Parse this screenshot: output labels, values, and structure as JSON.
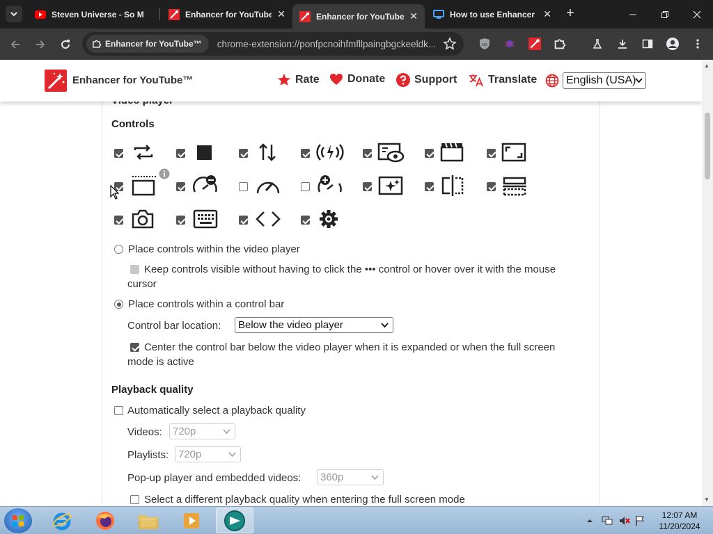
{
  "browser": {
    "tabs": [
      {
        "title": "Steven Universe - So M",
        "favicon": "youtube-icon",
        "active": false
      },
      {
        "title": "Enhancer for YouTube",
        "favicon": "enhancer-icon",
        "active": false
      },
      {
        "title": "Enhancer for YouTube",
        "favicon": "enhancer-icon",
        "active": true
      },
      {
        "title": "How to use Enhancer",
        "favicon": "monitor-icon",
        "active": false
      }
    ],
    "chip_label": "Enhancer for YouTube™",
    "url": "chrome-extension://ponfpcnoihfmfllpaingbgckeeldk..."
  },
  "header": {
    "title": "Enhancer for YouTube™",
    "links": {
      "rate": "Rate",
      "donate": "Donate",
      "support": "Support",
      "translate": "Translate"
    },
    "language": "English (USA)"
  },
  "sections": {
    "video_player_heading": "Video player",
    "controls_heading": "Controls",
    "playback_heading": "Playback quality"
  },
  "controls": {
    "place_within_player": "Place controls within the video player",
    "keep_visible": "Keep controls visible without having to click the ••• control or hover over it with the mouse",
    "keep_visible_2": "cursor",
    "place_in_bar": "Place controls within a control bar",
    "bar_location_label": "Control bar location:",
    "bar_location_value": "Below the video player",
    "center_bar": "Center the control bar below the video player when it is expanded or when the full screen",
    "center_bar_2": "mode is active"
  },
  "playback": {
    "auto_select": "Automatically select a playback quality",
    "videos_label": "Videos:",
    "videos_value": "720p",
    "playlists_label": "Playlists:",
    "playlists_value": "720p",
    "popup_label": "Pop-up player and embedded videos:",
    "popup_value": "360p",
    "fullscreen": "Select a different playback quality when entering the full screen mode"
  },
  "taskbar": {
    "time": "12:07 AM",
    "date": "11/20/2024"
  },
  "colors": {
    "accent_red": "#e0282d",
    "tab_bg": "#1f1f1f",
    "toolbar_bg": "#3a3a3a"
  }
}
